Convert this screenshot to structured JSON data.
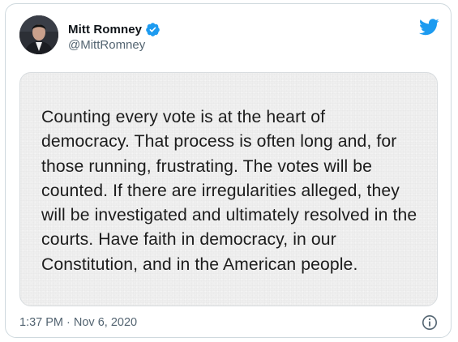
{
  "tweet": {
    "author": {
      "display_name": "Mitt Romney",
      "handle": "@MittRomney",
      "verified": true,
      "avatar_icon": "profile-photo"
    },
    "brand_icon": "twitter-bird-icon",
    "brand_color": "#1d9bf0",
    "image_text": "Counting every vote is at the heart of\ndemocracy. That process is often long and, for\nthose running, frustrating. The votes will be\ncounted. If there are irregularities alleged, they\nwill be investigated and ultimately resolved in the\ncourts. Have faith in democracy, in our\nConstitution, and in the American people.",
    "timestamp": "1:37 PM · Nov 6, 2020",
    "info_icon": "info-icon"
  }
}
